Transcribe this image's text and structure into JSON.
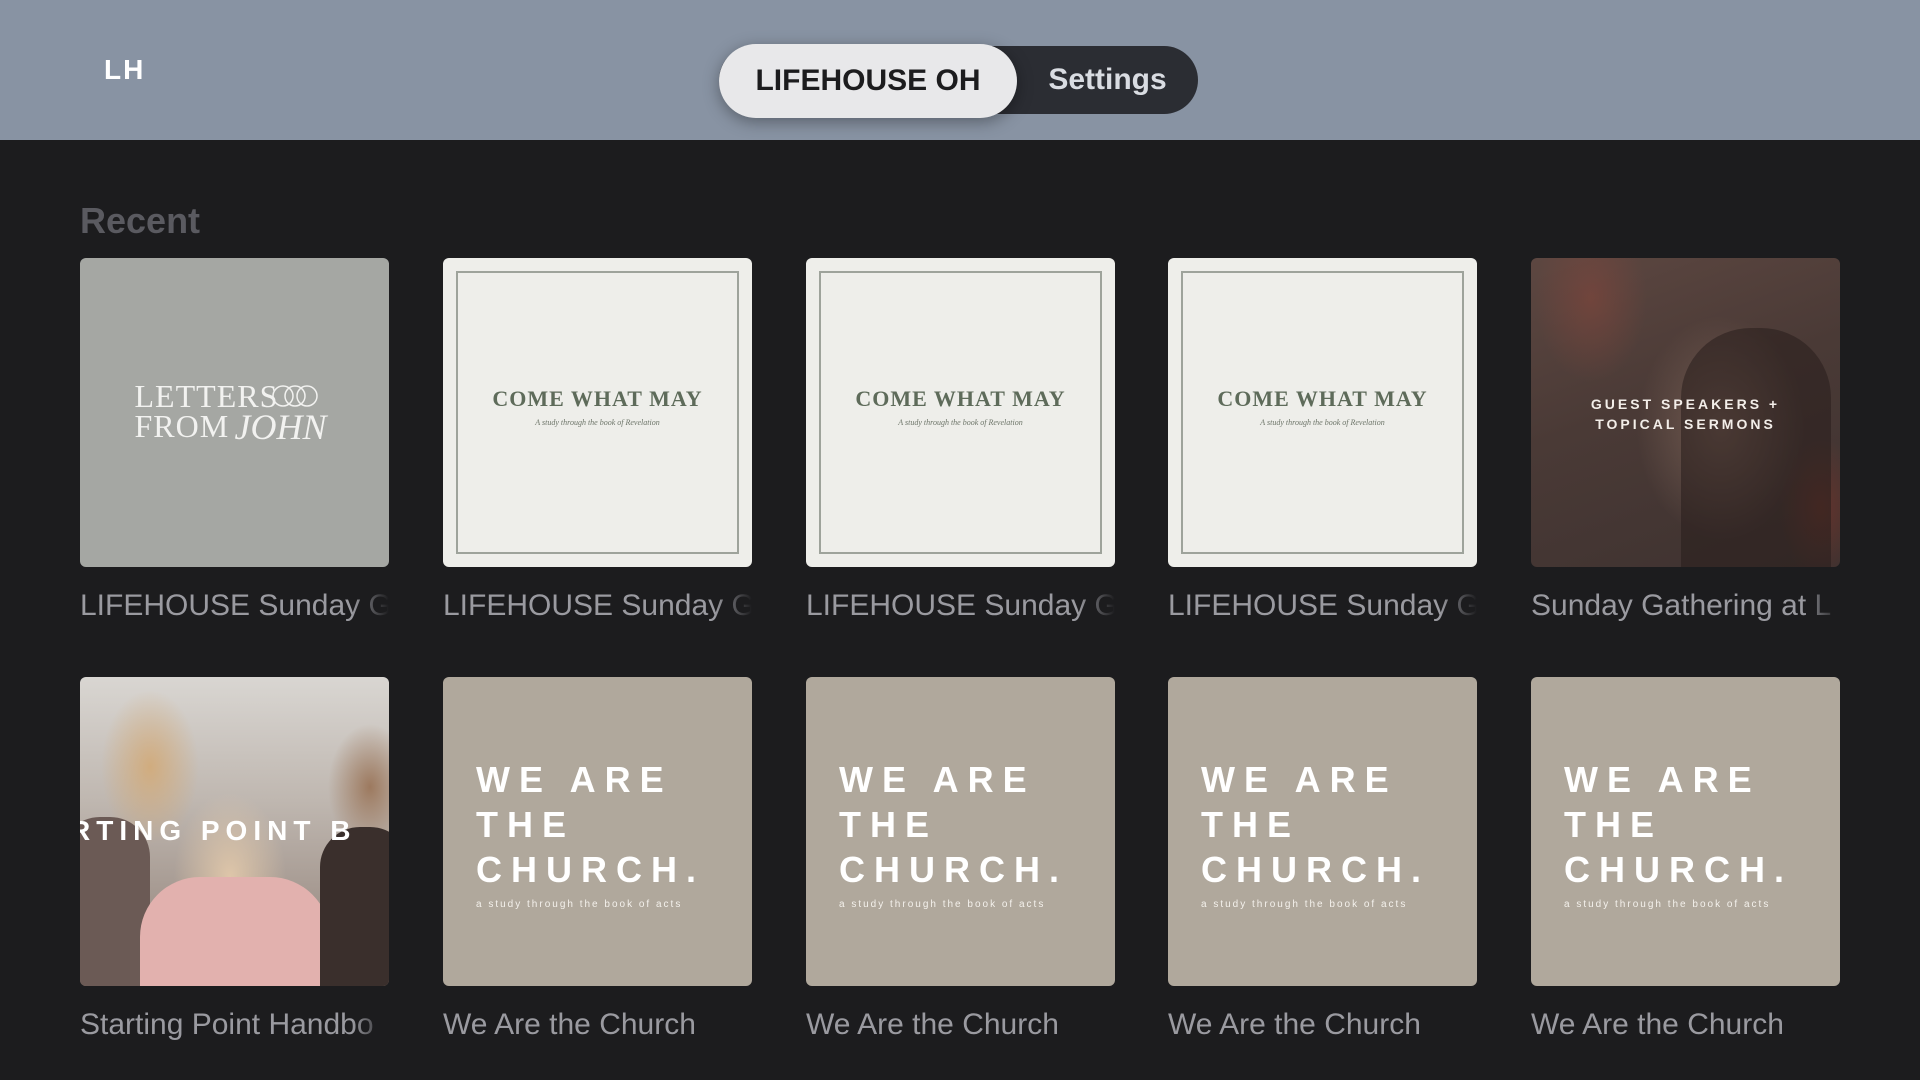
{
  "header": {
    "logo": "LH",
    "tabs": [
      {
        "label": "LIFEHOUSE OH",
        "active": true
      },
      {
        "label": "Settings",
        "active": false
      }
    ]
  },
  "section": {
    "title": "Recent"
  },
  "artwork": {
    "letters": {
      "line1": "LETTERS",
      "line2": "FROM",
      "john": "JOHN"
    },
    "cwm": {
      "title": "COME WHAT MAY",
      "subtitle": "A study through the book of Revelation"
    },
    "guest": {
      "line1": "GUEST SPEAKERS +",
      "line2": "TOPICAL SERMONS"
    },
    "start": {
      "text": "RTING POINT B"
    },
    "church": {
      "line1": "WE ARE",
      "line2": "THE",
      "line3": "CHURCH.",
      "subtitle": "a study through the book of acts"
    }
  },
  "rows": [
    [
      {
        "caption": "LIFEHOUSE Sunday G",
        "art": "letters"
      },
      {
        "caption": "LIFEHOUSE Sunday G",
        "art": "cwm"
      },
      {
        "caption": "LIFEHOUSE Sunday G",
        "art": "cwm"
      },
      {
        "caption": "LIFEHOUSE Sunday G",
        "art": "cwm"
      },
      {
        "caption": "Sunday Gathering at L",
        "art": "guest"
      }
    ],
    [
      {
        "caption": "Starting Point Handbo",
        "art": "start"
      },
      {
        "caption": "We Are the Church",
        "art": "church"
      },
      {
        "caption": "We Are the Church",
        "art": "church"
      },
      {
        "caption": "We Are the Church",
        "art": "church"
      },
      {
        "caption": "We Are the Church",
        "art": "church"
      }
    ]
  ],
  "colors": {
    "header_bg": "#8893a3",
    "page_bg": "#1c1c1e",
    "tab_active_bg": "#e8e8ea",
    "tab_bar_bg": "#2b2d33",
    "church_tile": "#b0a89c",
    "cwm_tile": "#eeeeea"
  }
}
